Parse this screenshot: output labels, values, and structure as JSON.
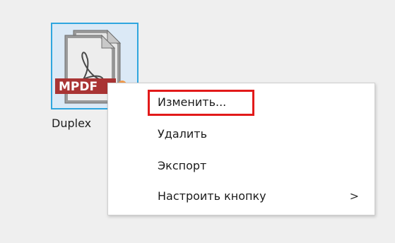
{
  "desktop_icon": {
    "badge_text": "MPDF",
    "label": "Duplex"
  },
  "context_menu": {
    "items": [
      {
        "label": "Изменить..."
      },
      {
        "label": "Удалить"
      },
      {
        "label": "Экспорт"
      },
      {
        "label": "Настроить кнопку",
        "submenu_chevron": ">"
      }
    ]
  },
  "colors": {
    "selection_border": "#2fa6df",
    "selection_fill": "#dbe9f6",
    "badge_red": "#a93434",
    "highlight_red": "#e21a1a",
    "menu_background": "#ffffff",
    "desktop_background": "#efefef"
  }
}
